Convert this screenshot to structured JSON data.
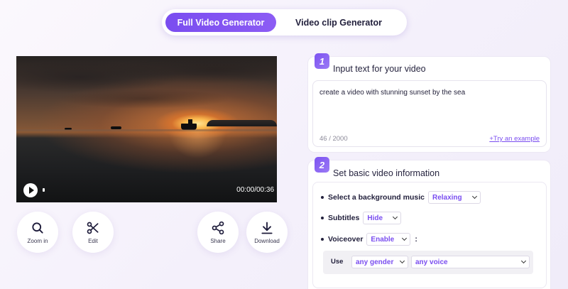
{
  "tabs": {
    "full_video": "Full Video Generator",
    "video_clip": "Video clip Generator"
  },
  "player": {
    "time": "00:00/00:36"
  },
  "tools": {
    "zoom": "Zoom in",
    "edit": "Edit",
    "share": "Share",
    "download": "Download"
  },
  "step1": {
    "number": "1",
    "title": "Input text for your video",
    "text": "create a video with stunning sunset by the sea",
    "counter": "46 / 2000",
    "try_example": "+Try an example"
  },
  "step2": {
    "number": "2",
    "title": "Set basic video information",
    "music_label": "Select a background music",
    "music_value": "Relaxing",
    "subtitles_label": "Subtitles",
    "subtitles_value": "Hide",
    "voiceover_label": "Voiceover",
    "voiceover_value": "Enable",
    "voiceover_colon": ":",
    "use_label": "Use",
    "gender_value": "any gender",
    "voice_value": "any voice"
  },
  "colors": {
    "accent": "#7a4df0",
    "background": "#f6f2fb"
  }
}
